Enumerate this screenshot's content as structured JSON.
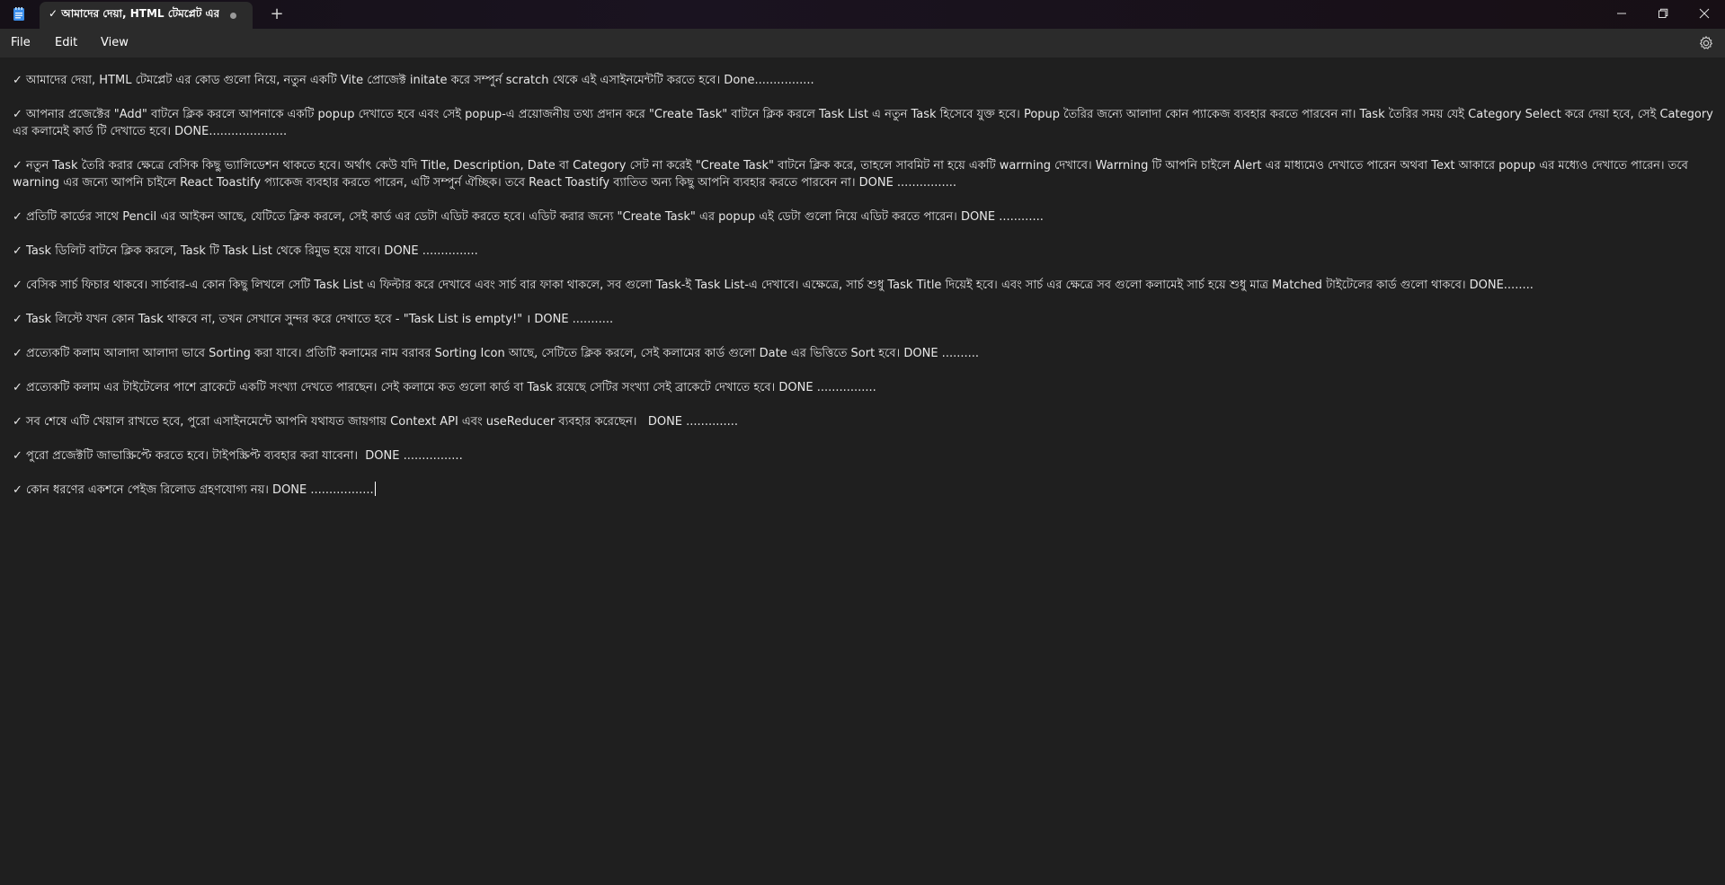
{
  "window": {
    "tab_title": "✓ আমাদের দেয়া, HTML টেমপ্লেট এর",
    "new_tab_label": "+",
    "minimize_icon": "minimize-icon",
    "maximize_icon": "restore-icon",
    "close_icon": "close-icon",
    "unsaved_indicator": "dot-icon"
  },
  "menu": {
    "file": "File",
    "edit": "Edit",
    "view": "View",
    "settings_icon": "gear-icon"
  },
  "document": {
    "lines": [
      "✓ আমাদের দেয়া, HTML টেমপ্লেট এর কোড গুলো নিয়ে, নতুন একটি Vite প্রোজেক্ট initate করে সম্পুর্ন scratch থেকে এই এসাইনমেন্টটি করতে হবে। Done................",
      "✓ আপনার প্রজেক্টের \"Add\" বাটনে ক্লিক করলে আপনাকে একটি popup দেখাতে হবে এবং সেই popup-এ প্রয়োজনীয় তথ্য প্রদান করে \"Create Task\" বাটনে ক্লিক করলে Task List এ নতুন Task হিসেবে যুক্ত হবে। Popup তৈরির জন্যে আলাদা কোন প্যাকেজ ব্যবহার করতে পারবেন না। Task তৈরির সময় যেই Category Select করে দেয়া হবে, সেই Category এর কলামেই কার্ড টি দেখাতে হবে। DONE.....................",
      "✓ নতুন Task তৈরি করার ক্ষেত্রে বেসিক কিছু ভ্যালিডেশন থাকতে হবে। অর্থাৎ কেউ যদি Title, Description, Date বা Category সেট না করেই \"Create Task\" বাটনে ক্লিক করে, তাহলে সাবমিট না হয়ে একটি warrning দেখাবে। Warrning টি আপনি চাইলে Alert এর মাধ্যমেও দেখাতে পারেন অথবা Text আকারে popup এর মধ্যেও দেখাতে পারেন। তবে warning এর জন্যে আপনি চাইলে React Toastify প্যাকেজ ব্যবহার করতে পারেন, এটি সম্পুর্ন ঐচ্ছিক। তবে React Toastify ব্যাতিত অন্য কিছু আপনি ব্যবহার করতে পারবেন না। DONE ................",
      "✓ প্রতিটি কার্ডের সাথে Pencil এর আইকন আছে, যেটিতে ক্লিক করলে, সেই কার্ড এর ডেটা এডিট করতে হবে। এডিট করার জন্যে \"Create Task\" এর popup এই ডেটা গুলো নিয়ে এডিট করতে পারেন। DONE ............",
      "✓ Task ডিলিট বাটনে ক্লিক করলে, Task টি Task List থেকে রিমুভ হয়ে যাবে। DONE ...............",
      "✓ বেসিক সার্চ ফিচার থাকবে। সার্চবার-এ কোন কিছু লিখলে সেটি Task List এ ফিল্টার করে দেখাবে এবং সার্চ বার ফাকা থাকলে, সব গুলো Task-ই Task List-এ দেখাবে। এক্ষেত্রে, সার্চ শুধু Task Title দিয়েই হবে। এবং সার্চ এর ক্ষেত্রে সব গুলো কলামেই সার্চ হয়ে শুধু মাত্র Matched টাইটেলের কার্ড গুলো থাকবে। DONE........",
      "✓ Task লিস্টে যখন কোন Task থাকবে না, তখন সেখানে সুন্দর করে দেখাতে হবে - \"Task List is empty!\" । DONE ...........",
      "✓ প্রত্যেকটি কলাম আলাদা আলাদা ভাবে Sorting করা যাবে। প্রতিটি কলামের নাম বরাবর Sorting Icon আছে, সেটিতে ক্লিক করলে, সেই কলামের কার্ড গুলো Date এর ভিত্তিতে Sort হবে। DONE ..........",
      "✓ প্রত্যেকটি কলাম এর টাইটেলের পাশে ব্রাকেটে একটি সংখ্যা দেখতে পারছেন। সেই কলামে কত গুলো কার্ড বা Task রয়েছে সেটির সংখ্যা সেই ব্রাকেটে দেখাতে হবে। DONE ................",
      "✓ সব শেষে এটি খেয়াল রাখতে হবে, পুরো এসাইনমেন্টে আপনি যথাযত জায়গায় Context API এবং useReducer ব্যবহার করেছেন।   DONE ..............",
      "✓ পুরো প্রজেক্টটি জাভাস্ক্রিপ্টে করতে হবে। টাইপস্ক্রিপ্ট ব্যবহার করা যাবেনা।  DONE ................",
      "✓ কোন ধরণের একশনে পেইজ রিলোড গ্রহণযোগ্য নয়। DONE ................."
    ]
  }
}
